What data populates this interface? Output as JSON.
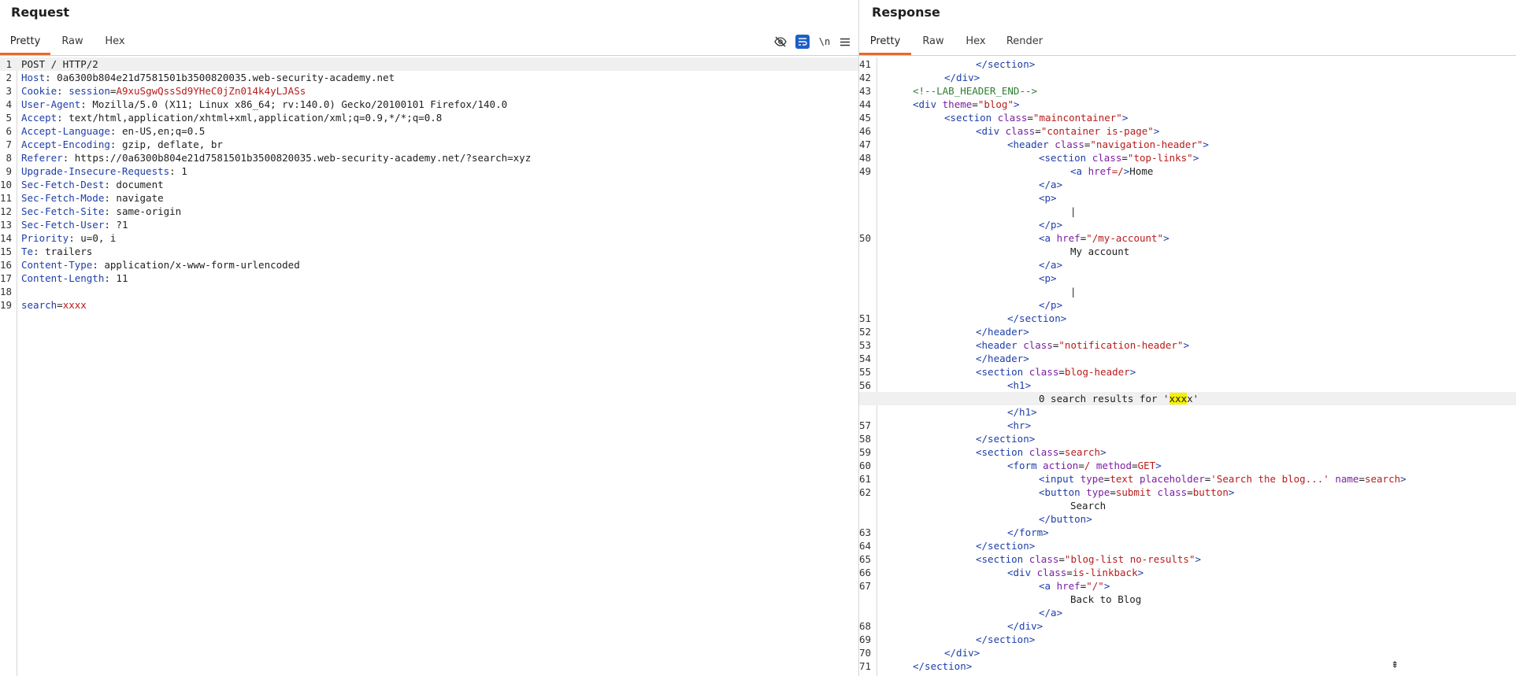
{
  "request": {
    "title": "Request",
    "tabs": [
      "Pretty",
      "Raw",
      "Hex"
    ],
    "active_tab": "Pretty",
    "tools": {
      "hide_icon": "eye-slash-icon",
      "wrap_icon": "wrap-lines-icon",
      "newline_label": "\\n",
      "menu_icon": "hamburger-menu-icon"
    },
    "request_line": "POST / HTTP/2",
    "headers": [
      {
        "name": "Host",
        "value": "0a6300b804e21d7581501b3500820035.web-security-academy.net"
      },
      {
        "name": "Cookie",
        "value": ""
      },
      {
        "name": "User-Agent",
        "value": "Mozilla/5.0 (X11; Linux x86_64; rv:140.0) Gecko/20100101 Firefox/140.0"
      },
      {
        "name": "Accept",
        "value": "text/html,application/xhtml+xml,application/xml;q=0.9,*/*;q=0.8"
      },
      {
        "name": "Accept-Language",
        "value": "en-US,en;q=0.5"
      },
      {
        "name": "Accept-Encoding",
        "value": "gzip, deflate, br"
      },
      {
        "name": "Referer",
        "value": "https://0a6300b804e21d7581501b3500820035.web-security-academy.net/?search=xyz"
      },
      {
        "name": "Upgrade-Insecure-Requests",
        "value": "1"
      },
      {
        "name": "Sec-Fetch-Dest",
        "value": "document"
      },
      {
        "name": "Sec-Fetch-Mode",
        "value": "navigate"
      },
      {
        "name": "Sec-Fetch-Site",
        "value": "same-origin"
      },
      {
        "name": "Sec-Fetch-User",
        "value": "?1"
      },
      {
        "name": "Priority",
        "value": "u=0, i"
      },
      {
        "name": "Te",
        "value": "trailers"
      },
      {
        "name": "Content-Type",
        "value": "application/x-www-form-urlencoded"
      },
      {
        "name": "Content-Length",
        "value": "11"
      }
    ],
    "cookie": {
      "name": "session",
      "value": "A9xuSgwQssSd9YHeC0jZn014k4yLJASs"
    },
    "body": {
      "name": "search",
      "value": "xxxx"
    },
    "line_numbers": [
      "1",
      "2",
      "3",
      "4",
      "5",
      "6",
      "7",
      "8",
      "9",
      "10",
      "11",
      "12",
      "13",
      "14",
      "15",
      "16",
      "17",
      "18",
      "19"
    ]
  },
  "response": {
    "title": "Response",
    "tabs": [
      "Pretty",
      "Raw",
      "Hex",
      "Render"
    ],
    "active_tab": "Pretty",
    "line_numbers": [
      "41",
      "42",
      "43",
      "44",
      "45",
      "46",
      "47",
      "48",
      "49",
      "50",
      "51",
      "52",
      "53",
      "54",
      "55",
      "56",
      "57",
      "58",
      "59",
      "60",
      "61",
      "62",
      "63",
      "64",
      "65",
      "66",
      "67",
      "68",
      "69",
      "70",
      "71"
    ],
    "strings": {
      "section_close": "</section>",
      "div_close": "</div>",
      "comment": "<!--LAB_HEADER_END-->",
      "div_open": "<div",
      "theme_attr": "theme",
      "theme_val": "\"blog\"",
      "section_open": "<section",
      "class_attr": "class",
      "maincontainer": "\"maincontainer\"",
      "container_is_page": "\"container is-page\"",
      "header_open": "<header",
      "navigation_header": "\"navigation-header\"",
      "top_links": "\"top-links\"",
      "a_open": "<a",
      "href_attr": "href",
      "href_root_unquoted": "=/",
      "home_text": "Home",
      "a_close": "</a>",
      "p_open": "<p>",
      "pipe": "|",
      "p_close": "</p>",
      "my_account_href": "\"/my-account\"",
      "my_account_text": "My account",
      "header_close": "</header>",
      "notification_header": "\"notification-header\"",
      "blog_header": "blog-header",
      "h1_open": "<h1>",
      "results_prefix": "0 search results for '",
      "results_mark": "xxx",
      "results_suffix": "x'",
      "h1_close": "</h1>",
      "hr": "<hr>",
      "search_class": "search",
      "form_open": "<form",
      "action_attr": "action",
      "action_val": "/",
      "method_attr": "method",
      "method_val": "GET",
      "input_open": "<input",
      "type_attr": "type",
      "text_val": "text",
      "placeholder_attr": "placeholder",
      "placeholder_val": "'Search the blog...'",
      "name_attr": "name",
      "name_val": "search",
      "button_open": "<button",
      "submit_val": "submit",
      "button_class_val": "button",
      "search_text": "Search",
      "button_close": "</button>",
      "form_close": "</form>",
      "blog_list": "\"blog-list no-results\"",
      "is_linkback": "is-linkback",
      "href_root_quoted": "\"/\"",
      "back_text": "Back to Blog"
    }
  },
  "colors": {
    "accent": "#e8682b",
    "header_name": "#1e3ea8",
    "string_value": "#b71c1c",
    "attribute": "#7b1fa2",
    "comment": "#2e7d32",
    "highlight": "#f5f000"
  }
}
